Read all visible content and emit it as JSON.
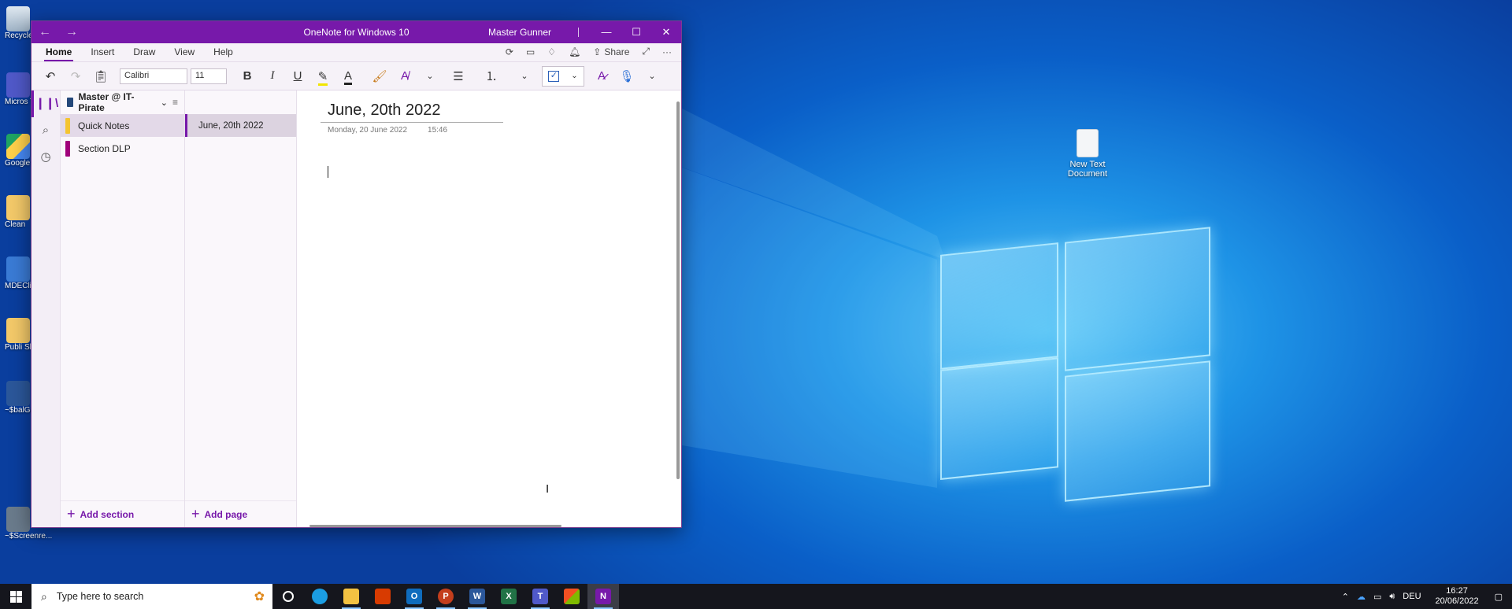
{
  "window": {
    "title": "OneNote for Windows 10",
    "user": "Master Gunner",
    "back": "←",
    "forward": "→",
    "minimize": "—",
    "maximize": "☐",
    "close": "✕"
  },
  "menu": {
    "tabs": [
      "Home",
      "Insert",
      "Draw",
      "View",
      "Help"
    ],
    "active": "Home",
    "share_label": "Share"
  },
  "toolbar": {
    "font_name": "Calibri",
    "font_size": "11",
    "bold": "B",
    "italic": "I",
    "underline": "U",
    "font_color": "A"
  },
  "notebook": {
    "name": "Master @ IT-Pirate",
    "sections": [
      {
        "name": "Quick Notes",
        "color": "#f4c430"
      },
      {
        "name": "Section DLP",
        "color": "#a0007a"
      }
    ],
    "add_section_label": "Add section",
    "add_page_label": "Add page"
  },
  "pages": [
    {
      "title": "June, 20th 2022"
    }
  ],
  "note": {
    "title": "June, 20th 2022",
    "date": "Monday, 20 June 2022",
    "time": "15:46"
  },
  "desktop": {
    "icons": [
      {
        "label": "Recycle"
      },
      {
        "label": "Micros Team"
      },
      {
        "label": "Google"
      },
      {
        "label": "Clean"
      },
      {
        "label": "MDEClie"
      },
      {
        "label": "Publi Short"
      },
      {
        "label": "~$balGe File"
      },
      {
        "label": "~$Screenre..."
      }
    ],
    "new_text_document": "New Text Document"
  },
  "taskbar": {
    "search_placeholder": "Type here to search",
    "language": "DEU",
    "time": "16:27",
    "date": "20/06/2022"
  }
}
